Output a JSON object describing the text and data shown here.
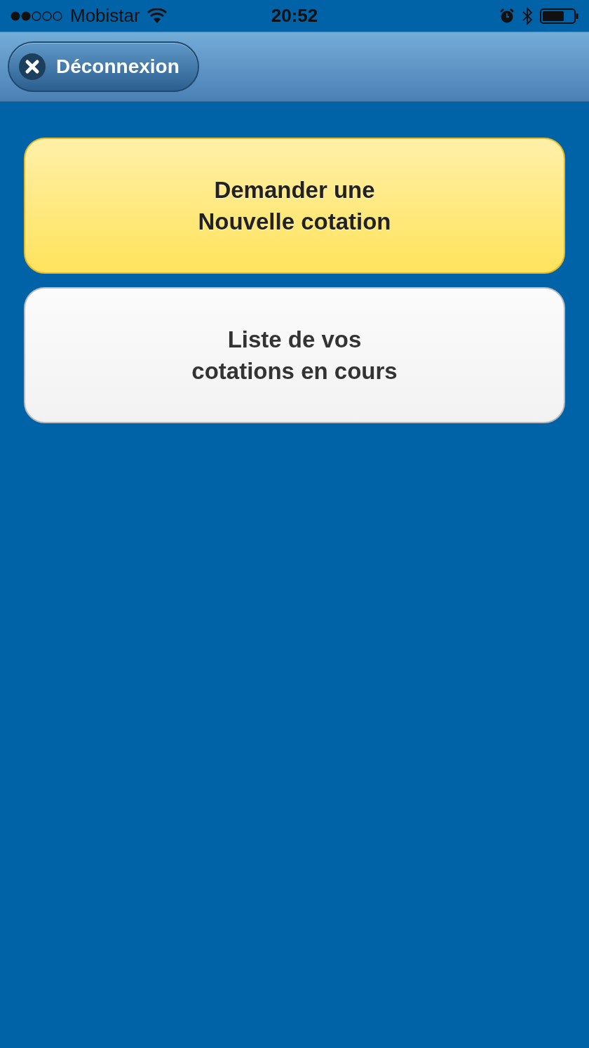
{
  "status_bar": {
    "carrier": "Mobistar",
    "time": "20:52"
  },
  "nav_bar": {
    "logout_button": {
      "label": "Déconnexion"
    }
  },
  "menu_buttons": [
    {
      "kind": "primary",
      "label": "Demander une\nNouvelle cotation"
    },
    {
      "kind": "secondary",
      "label": "Liste de vos\ncotations en cours"
    }
  ]
}
